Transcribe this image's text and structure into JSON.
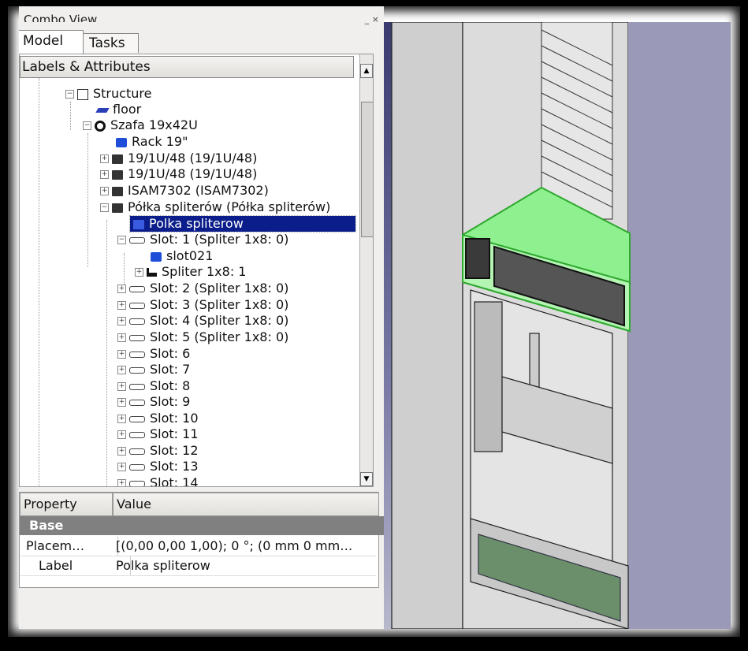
{
  "combo_view": {
    "title": "Combo View",
    "controls": "_ ×"
  },
  "tabs": [
    {
      "label": "Model"
    },
    {
      "label": "Tasks"
    }
  ],
  "tree": {
    "header": "Labels & Attributes",
    "scroll_up": "▲",
    "scroll_down": "▼",
    "items": [
      {
        "label": "Structure",
        "icon": "structure-icon"
      },
      {
        "label": "floor",
        "icon": "floor-icon"
      },
      {
        "label": "Szafa 19x42U",
        "icon": "assembly-icon"
      },
      {
        "label": "Rack 19\"",
        "icon": "cube-icon"
      },
      {
        "label": "19/1U/48 (19/1U/48)",
        "icon": "device-icon"
      },
      {
        "label": "19/1U/48 (19/1U/48)",
        "icon": "device-icon"
      },
      {
        "label": "ISAM7302 (ISAM7302)",
        "icon": "device-icon"
      },
      {
        "label": "Półka spliterów (Półka spliterów)",
        "icon": "device-icon"
      },
      {
        "label": "Polka spliterow",
        "icon": "cube-icon"
      },
      {
        "label": "Slot: 1 (Spliter 1x8: 0)",
        "icon": "slot-icon"
      },
      {
        "label": "slot021",
        "icon": "cube-icon"
      },
      {
        "label": "Spliter 1x8: 1",
        "icon": "splitter-icon"
      },
      {
        "label": "Slot: 2 (Spliter 1x8: 0)",
        "icon": "slot-icon"
      },
      {
        "label": "Slot: 3 (Spliter 1x8: 0)",
        "icon": "slot-icon"
      },
      {
        "label": "Slot: 4 (Spliter 1x8: 0)",
        "icon": "slot-icon"
      },
      {
        "label": "Slot: 5 (Spliter 1x8: 0)",
        "icon": "slot-icon"
      },
      {
        "label": "Slot: 6",
        "icon": "slot-icon"
      },
      {
        "label": "Slot: 7",
        "icon": "slot-icon"
      },
      {
        "label": "Slot: 8",
        "icon": "slot-icon"
      },
      {
        "label": "Slot: 9",
        "icon": "slot-icon"
      },
      {
        "label": "Slot: 10",
        "icon": "slot-icon"
      },
      {
        "label": "Slot: 11",
        "icon": "slot-icon"
      },
      {
        "label": "Slot: 12",
        "icon": "slot-icon"
      },
      {
        "label": "Slot: 13",
        "icon": "slot-icon"
      },
      {
        "label": "Slot: 14",
        "icon": "slot-icon"
      }
    ]
  },
  "properties": {
    "col_property": "Property",
    "col_value": "Value",
    "group": "Base",
    "rows": [
      {
        "name": "Placem…",
        "value": "[(0,00 0,00 1,00); 0 °; (0 mm  0 mm…"
      },
      {
        "name": "Label",
        "value": "Polka spliterow"
      }
    ]
  },
  "colors": {
    "selection": "#0a1d8a",
    "highlight": "#8ef08e",
    "cube": "#1e4ed8"
  }
}
